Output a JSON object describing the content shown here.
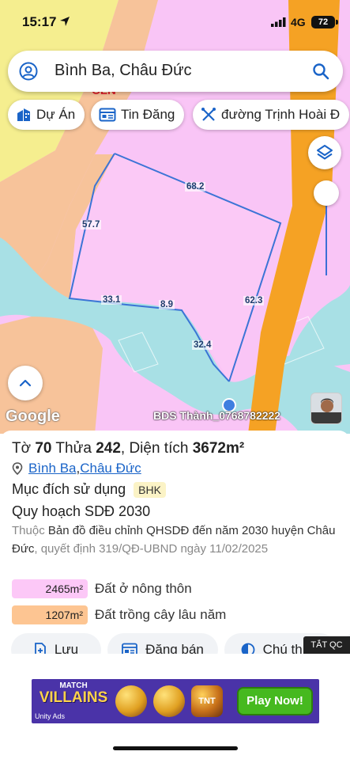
{
  "status": {
    "time": "15:17",
    "network": "4G",
    "battery": "72"
  },
  "search": {
    "query": "Bình Ba, Châu Đức"
  },
  "chips": [
    {
      "label": "Dự Án",
      "icon": "building-icon"
    },
    {
      "label": "Tin Đăng",
      "icon": "listing-icon"
    },
    {
      "label": "đường Trịnh Hoài Đ",
      "icon": "ruler-icon"
    }
  ],
  "map": {
    "area_label": "CLN",
    "segments": [
      "68.2",
      "57.7",
      "33.1",
      "8.9",
      "62.3",
      "32.4"
    ],
    "google": "Google",
    "watermark": "BDS Thành_0768782222"
  },
  "panel": {
    "title_prefix": "Tờ ",
    "sheet": "70",
    "parcel_prefix": " Thửa ",
    "parcel": "242",
    "area_prefix": ", Diện tích ",
    "area": "3672m²",
    "location": {
      "ward": "Bình Ba",
      "separator": ", ",
      "district": "Châu Đức"
    },
    "purpose_label": "Mục đích sử dụng",
    "purpose_code": "BHK",
    "plan_title": "Quy hoạch SDĐ 2030",
    "desc_prefix": "Thuộc ",
    "desc_map": "Bản đồ điều chỉnh QHSDĐ đến năm 2030 huyện Châu Đức",
    "desc_suffix": ", quyết định 319/QĐ-UBND ngày 11/02/2025",
    "legend": [
      {
        "value": "2465m²",
        "label": "Đất ở nông thôn",
        "color": "#fcc8f7"
      },
      {
        "value": "1207m²",
        "label": "Đất trồng cây lâu năm",
        "color": "#fdc592"
      }
    ],
    "actions": [
      {
        "label": "Lưu",
        "icon": "save-icon"
      },
      {
        "label": "Đăng bán",
        "icon": "post-icon"
      },
      {
        "label": "Chú thích",
        "icon": "legend-icon"
      }
    ]
  },
  "ad": {
    "tag": "TẮT QC",
    "title_line1": "MATCH",
    "title_line2": "VILLAINS",
    "brand": "Unity Ads",
    "cta": "Play Now!",
    "tnt": "TNT"
  },
  "colors": {
    "map_pink": "#f9c5f6",
    "map_orange": "#f5c08e",
    "map_yellow": "#f6f48c",
    "water": "#a8e0e5",
    "road": "#f5a224",
    "boundary": "#3b74d6",
    "link": "#1a64c8"
  }
}
